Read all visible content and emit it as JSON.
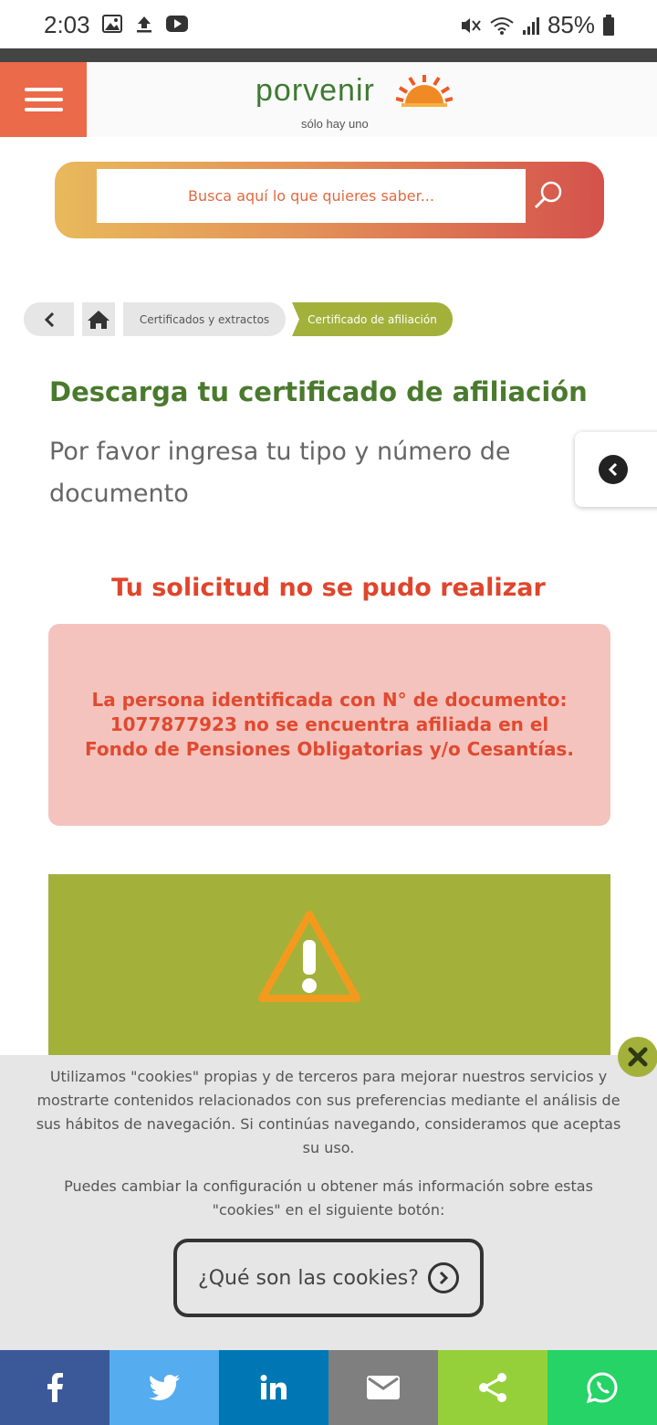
{
  "status_bar": {
    "time": "2:03",
    "battery": "85%",
    "icons": [
      "image-icon",
      "upload-icon",
      "youtube-icon",
      "mute-icon",
      "wifi-icon",
      "signal-icon",
      "battery-icon"
    ]
  },
  "header": {
    "brand": "porvenir",
    "tagline": "sólo hay uno",
    "menu_color": "#ea6a49"
  },
  "search": {
    "placeholder": "Busca aquí lo que quieres saber..."
  },
  "breadcrumb": {
    "items": [
      "Certificados y extractos",
      "Certificado de afiliación"
    ]
  },
  "main": {
    "title": "Descarga tu certificado de afiliación",
    "subtitle": "Por favor ingresa tu tipo y número de documento",
    "error_title": "Tu solicitud no se pudo realizar",
    "error_message": "La persona identificada con N° de documento: 1077877923 no se encuentra afiliada en el Fondo de Pensiones Obligatorias y/o Cesantías."
  },
  "cookies": {
    "text1": "Utilizamos \"cookies\" propias y de terceros para mejorar nuestros servicios y mostrarte contenidos relacionados con sus preferencias mediante el análisis de sus hábitos de navegación. Si continúas navegando, consideramos que aceptas su uso.",
    "text2": "Puedes cambiar la configuración u obtener más información sobre estas \"cookies\" en el siguiente botón:",
    "button_label": "¿Qué son las cookies?"
  },
  "share_bar": {
    "items": [
      {
        "name": "facebook-icon",
        "color": "#3b5998"
      },
      {
        "name": "twitter-icon",
        "color": "#55acee"
      },
      {
        "name": "linkedin-icon",
        "color": "#0077b5"
      },
      {
        "name": "email-icon",
        "color": "#7f7f7f"
      },
      {
        "name": "share-icon",
        "color": "#95d03a"
      },
      {
        "name": "whatsapp-icon",
        "color": "#25d366"
      }
    ]
  },
  "colors": {
    "accent_green": "#a3b13b",
    "title_green": "#4a7a2e",
    "error_red": "#e0452c",
    "error_bg": "#f4c3bd"
  }
}
